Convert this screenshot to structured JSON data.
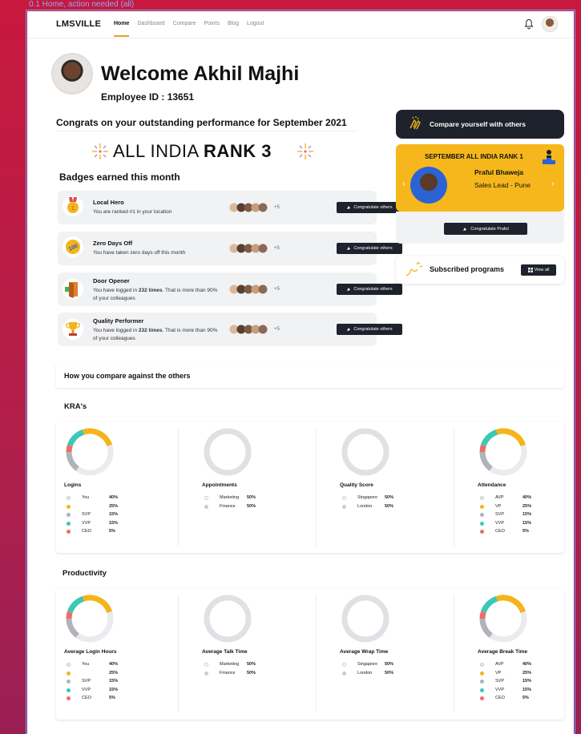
{
  "frame_label": "0.1 Home, action needed (all)",
  "nav": {
    "brand": "LMSVILLE",
    "links": [
      "Home",
      "Dashboard",
      "Compare",
      "Points",
      "Blog",
      "Logout"
    ]
  },
  "profile": {
    "welcome": "Welcome Akhil Majhi",
    "employee_id": "Employee ID : 13651"
  },
  "congrats": "Congrats on your outstanding performance for September 2021",
  "rank_prefix": "ALL INDIA ",
  "rank_value": "RANK 3",
  "badges_title": "Badges earned this month",
  "badges": [
    {
      "name": "Local Hero",
      "desc": "You are ranked #1 in your location",
      "desc_bold": "",
      "desc_after": "",
      "more": "+5",
      "button": "Congratulate others",
      "icon": "medal-icon"
    },
    {
      "name": "Zero Days Off",
      "desc": "You have taken zero days off this month",
      "desc_bold": "",
      "desc_after": "",
      "more": "+5",
      "button": "Congratulate others",
      "icon": "hundred-icon"
    },
    {
      "name": "Door Opener",
      "desc": "You have logged in ",
      "desc_bold": "232 times",
      "desc_after": ". That is more than 90% of your colleagues",
      "more": "+5",
      "button": "Congratulate others",
      "icon": "door-icon"
    },
    {
      "name": "Quality Performer",
      "desc": "You have logged in ",
      "desc_bold": "232 times",
      "desc_after": ". That is more than 90% of your colleagues",
      "more": "+5",
      "button": "Congratulate others",
      "icon": "trophy-icon"
    }
  ],
  "compare_button": "Compare yourself with others",
  "rank_card": {
    "heading": "SEPTEMBER ALL INDIA RANK 1",
    "name": "Praful Bhaweja",
    "role": "Sales Lead - Pune",
    "button": "Congratulate Praful"
  },
  "subscribed": {
    "title": "Subscribed programs",
    "button": "View all"
  },
  "compare_section": "How you compare against the others",
  "kra_title": "KRA's",
  "productivity_title": "Productivity",
  "colors": {
    "teal": "#3cc8b4",
    "yellow": "#f4b41a",
    "grey": "#b0b3ba",
    "red": "#f26a6a",
    "light": "#e3e5e9",
    "dark": "#1e222c"
  },
  "chart_data": [
    {
      "type": "pie",
      "title": "Logins",
      "series": [
        {
          "label": "You",
          "value": 40,
          "color": "#e3e5e9"
        },
        {
          "label": "",
          "value": 25,
          "color": "#f4b41a"
        },
        {
          "label": "SVP",
          "value": 15,
          "color": "#b0b3ba"
        },
        {
          "label": "VVP",
          "value": 15,
          "color": "#3cc8b4"
        },
        {
          "label": "CEO",
          "value": 5,
          "color": "#f26a6a"
        }
      ]
    },
    {
      "type": "pie",
      "title": "Appointments",
      "series": [
        {
          "label": "Marketing",
          "value": 50,
          "color": "#ffffff"
        },
        {
          "label": "Finance",
          "value": 50,
          "color": "#c9ccd2"
        }
      ]
    },
    {
      "type": "pie",
      "title": "Quality Score",
      "series": [
        {
          "label": "Singapore",
          "value": 50,
          "color": "#ffffff"
        },
        {
          "label": "London",
          "value": 50,
          "color": "#c9ccd2"
        }
      ]
    },
    {
      "type": "pie",
      "title": "Attendance",
      "series": [
        {
          "label": "AVP",
          "value": 40,
          "color": "#e3e5e9"
        },
        {
          "label": "VP",
          "value": 25,
          "color": "#f4b41a"
        },
        {
          "label": "SVP",
          "value": 15,
          "color": "#b0b3ba"
        },
        {
          "label": "VVP",
          "value": 15,
          "color": "#3cc8b4"
        },
        {
          "label": "CEO",
          "value": 5,
          "color": "#f26a6a"
        }
      ]
    },
    {
      "type": "pie",
      "title": "Average Login Hours",
      "series": [
        {
          "label": "You",
          "value": 40,
          "color": "#e3e5e9"
        },
        {
          "label": "",
          "value": 25,
          "color": "#f4b41a"
        },
        {
          "label": "SVP",
          "value": 15,
          "color": "#b0b3ba"
        },
        {
          "label": "VVP",
          "value": 15,
          "color": "#3cc8b4"
        },
        {
          "label": "CEO",
          "value": 5,
          "color": "#f26a6a"
        }
      ]
    },
    {
      "type": "pie",
      "title": "Average Talk Time",
      "series": [
        {
          "label": "Marketing",
          "value": 50,
          "color": "#ffffff"
        },
        {
          "label": "Finance",
          "value": 50,
          "color": "#c9ccd2"
        }
      ]
    },
    {
      "type": "pie",
      "title": "Average Wrap Time",
      "series": [
        {
          "label": "Singapore",
          "value": 50,
          "color": "#ffffff"
        },
        {
          "label": "London",
          "value": 50,
          "color": "#c9ccd2"
        }
      ]
    },
    {
      "type": "pie",
      "title": "Average Break Time",
      "series": [
        {
          "label": "AVP",
          "value": 40,
          "color": "#e3e5e9"
        },
        {
          "label": "VP",
          "value": 25,
          "color": "#f4b41a"
        },
        {
          "label": "SVP",
          "value": 15,
          "color": "#b0b3ba"
        },
        {
          "label": "VVP",
          "value": 15,
          "color": "#3cc8b4"
        },
        {
          "label": "CEO",
          "value": 5,
          "color": "#f26a6a"
        }
      ]
    }
  ]
}
